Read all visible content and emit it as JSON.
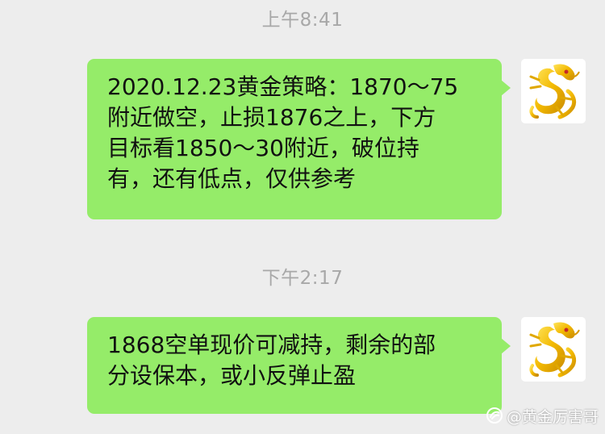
{
  "colors": {
    "background": "#ededed",
    "bubble": "#95ec69",
    "timestamp": "#a8a8a8",
    "text": "#111111"
  },
  "messages": [
    {
      "timestamp": "上午8:41",
      "lines": [
        "2020.12.23黄金策略：1870～75",
        "附近做空，止损1876之上，下方",
        "目标看1850～30附近，破位持",
        "有，还有低点，仅供参考"
      ],
      "avatar": "golden-dragon-avatar"
    },
    {
      "timestamp": "下午2:17",
      "lines": [
        "1868空单现价可减持，剩余的部",
        "分设保本，或小反弹止盈"
      ],
      "avatar": "golden-dragon-avatar"
    }
  ],
  "watermark": {
    "text": "@黄金厉害哥",
    "icon": "platform-logo-icon"
  }
}
